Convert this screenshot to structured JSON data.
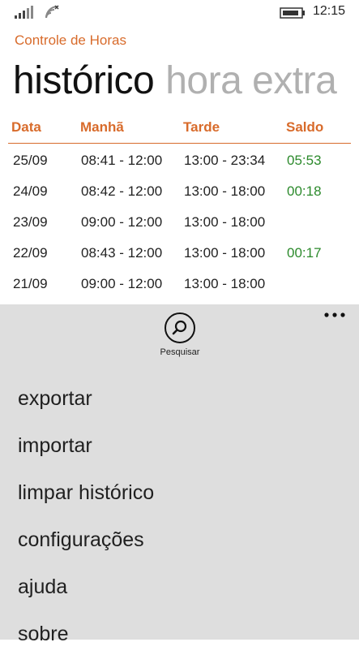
{
  "status": {
    "time": "12:15"
  },
  "app": {
    "title": "Controle de Horas"
  },
  "pivot": {
    "items": [
      "histórico",
      "hora extra"
    ]
  },
  "table": {
    "headers": [
      "Data",
      "Manhã",
      "Tarde",
      "Saldo"
    ],
    "rows": [
      {
        "data": "25/09",
        "manha": "08:41 - 12:00",
        "tarde": "13:00 - 23:34",
        "saldo": "05:53"
      },
      {
        "data": "24/09",
        "manha": "08:42 - 12:00",
        "tarde": "13:00 - 18:00",
        "saldo": "00:18"
      },
      {
        "data": "23/09",
        "manha": "09:00 - 12:00",
        "tarde": "13:00 - 18:00",
        "saldo": ""
      },
      {
        "data": "22/09",
        "manha": "08:43 - 12:00",
        "tarde": "13:00 - 18:00",
        "saldo": "00:17"
      },
      {
        "data": "21/09",
        "manha": "09:00 - 12:00",
        "tarde": "13:00 - 18:00",
        "saldo": ""
      }
    ]
  },
  "appbar": {
    "search_label": "Pesquisar",
    "menu": [
      "exportar",
      "importar",
      "limpar histórico",
      "configurações",
      "ajuda",
      "sobre"
    ]
  },
  "colors": {
    "accent": "#d86b2b",
    "positive": "#2c8a2c",
    "appbar_bg": "#dedede"
  },
  "icons": [
    "signal-icon",
    "wifi-icon",
    "battery-icon",
    "search-icon",
    "more-icon"
  ]
}
